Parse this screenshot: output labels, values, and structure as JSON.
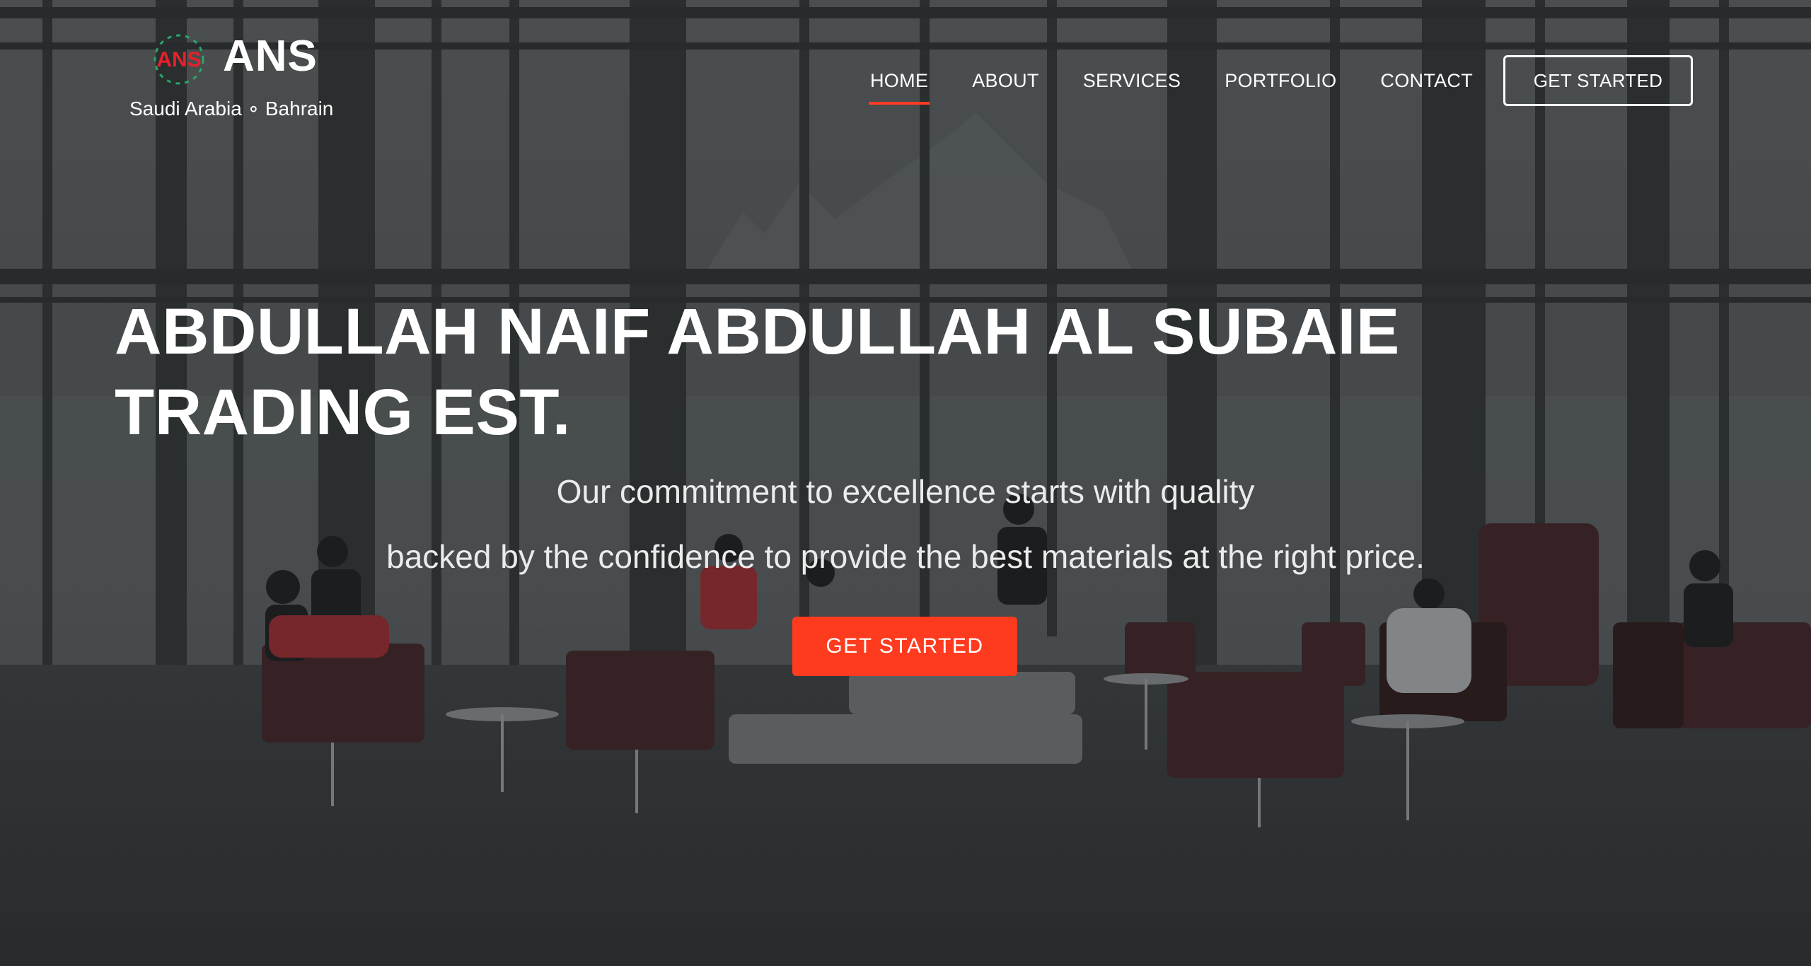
{
  "brand": {
    "logo_mark_text": "ANS",
    "title": "ANS",
    "subtitle": "Saudi Arabia ∘ Bahrain",
    "mark_color": "#e8202a",
    "mark_ring_color": "#2aa66a"
  },
  "nav": {
    "items": [
      {
        "label": "HOME",
        "active": true
      },
      {
        "label": "ABOUT",
        "active": false
      },
      {
        "label": "SERVICES",
        "active": false
      },
      {
        "label": "PORTFOLIO",
        "active": false
      },
      {
        "label": "CONTACT",
        "active": false
      }
    ],
    "cta_label": "GET STARTED",
    "active_underline_color": "#ff3b23"
  },
  "hero": {
    "headline_line1": "ABDULLAH NAIF ABDULLAH AL SUBAIE",
    "headline_line2": "TRADING EST.",
    "tagline_line1": "Our commitment to excellence starts with quality",
    "tagline_line2": "backed by the confidence to provide the best materials at the right price.",
    "cta_label": "GET STARTED",
    "cta_color": "#ff3b1f"
  }
}
